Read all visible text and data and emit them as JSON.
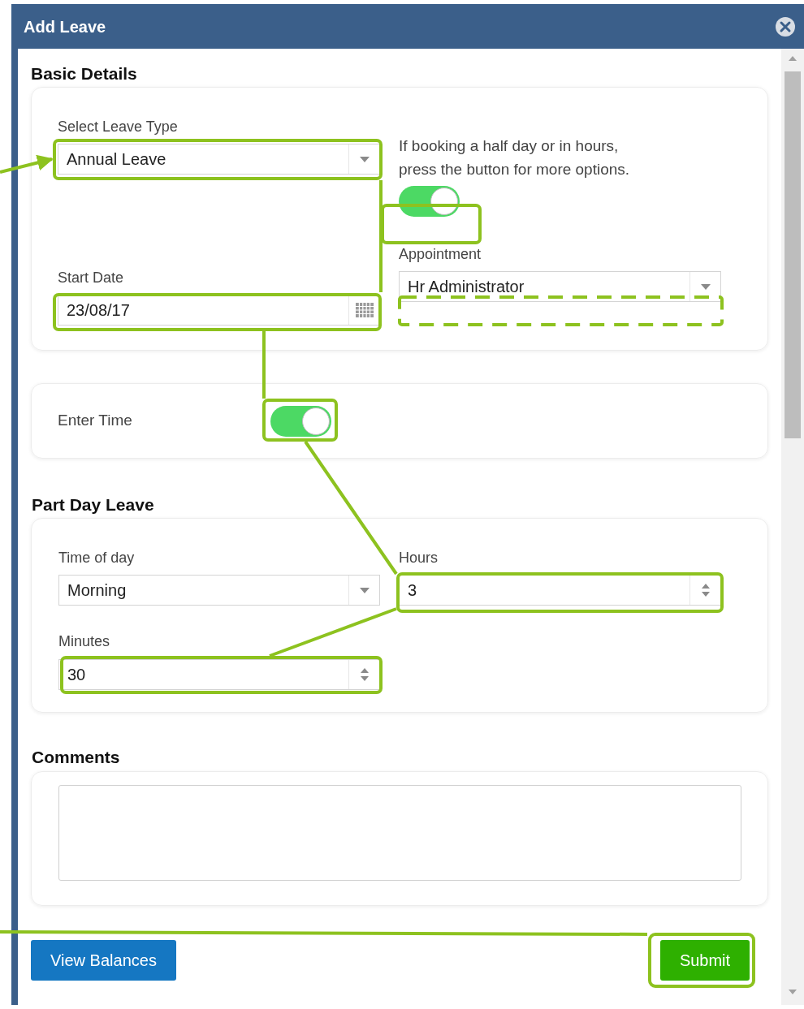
{
  "window": {
    "title": "Add Leave"
  },
  "basic_details": {
    "heading": "Basic Details",
    "leave_type": {
      "label": "Select Leave Type",
      "value": "Annual Leave"
    },
    "hint": "If booking a half day or in hours, press the button for more options.",
    "half_day_toggle": {
      "on": true
    },
    "start_date": {
      "label": "Start Date",
      "value": "23/08/17"
    },
    "appointment": {
      "label": "Appointment",
      "value": "Hr Administrator"
    }
  },
  "enter_time": {
    "label": "Enter Time",
    "on": true
  },
  "part_day_leave": {
    "heading": "Part Day Leave",
    "time_of_day": {
      "label": "Time of day",
      "value": "Morning"
    },
    "hours": {
      "label": "Hours",
      "value": "3"
    },
    "minutes": {
      "label": "Minutes",
      "value": "30"
    }
  },
  "comments": {
    "heading": "Comments"
  },
  "buttons": [
    {
      "label": "View Balances",
      "kind": "secondary"
    },
    {
      "label": "Submit",
      "kind": "primary"
    }
  ]
}
